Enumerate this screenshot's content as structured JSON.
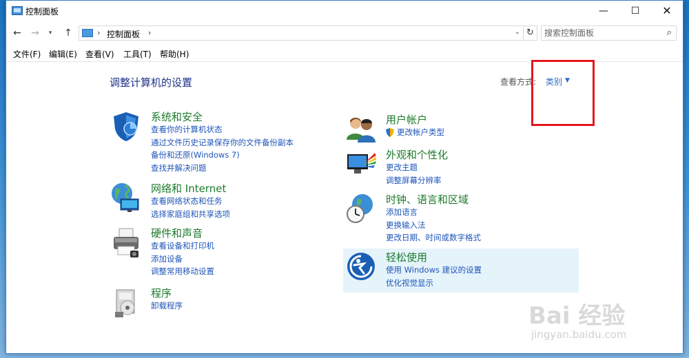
{
  "window": {
    "title": "控制面板",
    "min_glyph": "—",
    "max_glyph": "☐",
    "close_glyph": "✕"
  },
  "address": {
    "back_glyph": "←",
    "forward_glyph": "→",
    "history_glyph": "▾",
    "up_glyph": "↑",
    "separator": "›",
    "crumb": "控制面板",
    "dropdown_glyph": "⌄",
    "refresh_glyph": "↻"
  },
  "search": {
    "placeholder": "搜索控制面板",
    "icon_glyph": "⌕"
  },
  "menu": {
    "file": "文件(F)",
    "edit": "编辑(E)",
    "view": "查看(V)",
    "tools": "工具(T)",
    "help": "帮助(H)"
  },
  "header": {
    "title": "调整计算机的设置",
    "view_by_label": "查看方式:",
    "view_by_value": "类别",
    "view_by_caret": "▼"
  },
  "categories": {
    "security": {
      "title": "系统和安全",
      "links": [
        "查看你的计算机状态",
        "通过文件历史记录保存你的文件备份副本",
        "备份和还原(Windows 7)",
        "查找并解决问题"
      ]
    },
    "network": {
      "title": "网络和 Internet",
      "links": [
        "查看网络状态和任务",
        "选择家庭组和共享选项"
      ]
    },
    "hardware": {
      "title": "硬件和声音",
      "links": [
        "查看设备和打印机",
        "添加设备",
        "调整常用移动设置"
      ]
    },
    "programs": {
      "title": "程序",
      "links": [
        "卸载程序"
      ]
    },
    "accounts": {
      "title": "用户帐户",
      "links": [
        "更改帐户类型"
      ]
    },
    "appearance": {
      "title": "外观和个性化",
      "links": [
        "更改主题",
        "调整屏幕分辨率"
      ]
    },
    "clock": {
      "title": "时钟、语言和区域",
      "links": [
        "添加语言",
        "更换输入法",
        "更改日期、时间或数字格式"
      ]
    },
    "ease": {
      "title": "轻松使用",
      "links": [
        "使用 Windows 建议的设置",
        "优化视觉显示"
      ]
    }
  },
  "watermark": {
    "brand": "Bai  经验",
    "url": "jingyan.baidu.com"
  }
}
